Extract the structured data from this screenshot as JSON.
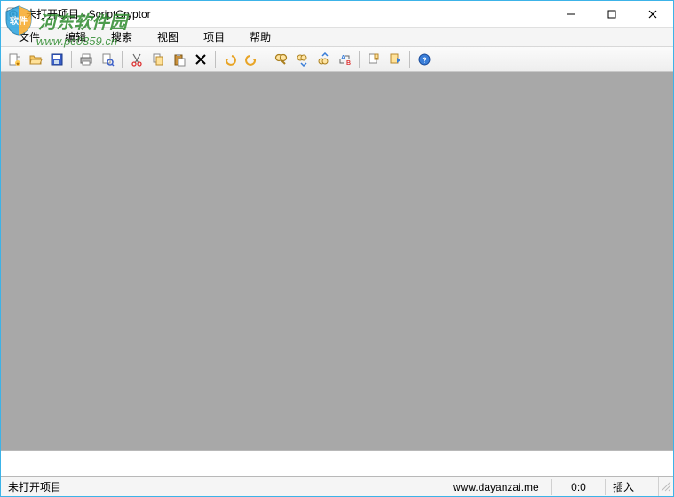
{
  "titlebar": {
    "title": "未打开项目 - ScriptCryptor"
  },
  "menus": {
    "file": "文件",
    "edit": "编辑",
    "search": "搜索",
    "view": "视图",
    "project": "项目",
    "help": "帮助"
  },
  "toolbar": {
    "icons": {
      "new": "new-file",
      "open": "open-folder",
      "save": "save",
      "print": "print",
      "preview": "print-preview",
      "cut": "cut",
      "copy": "copy",
      "paste": "paste",
      "delete": "delete",
      "undo": "undo",
      "redo": "redo",
      "find": "find",
      "findnext": "find-next",
      "findprev": "find-prev",
      "replace": "replace",
      "toggle_bm": "bookmark-toggle",
      "next_bm": "bookmark-next",
      "about": "about"
    }
  },
  "statusbar": {
    "project": "未打开项目",
    "url": "www.dayanzai.me",
    "pos": "0:0",
    "mode": "插入"
  },
  "watermark": {
    "brand": "河东软件园",
    "url": "www.pc0359.cn"
  }
}
